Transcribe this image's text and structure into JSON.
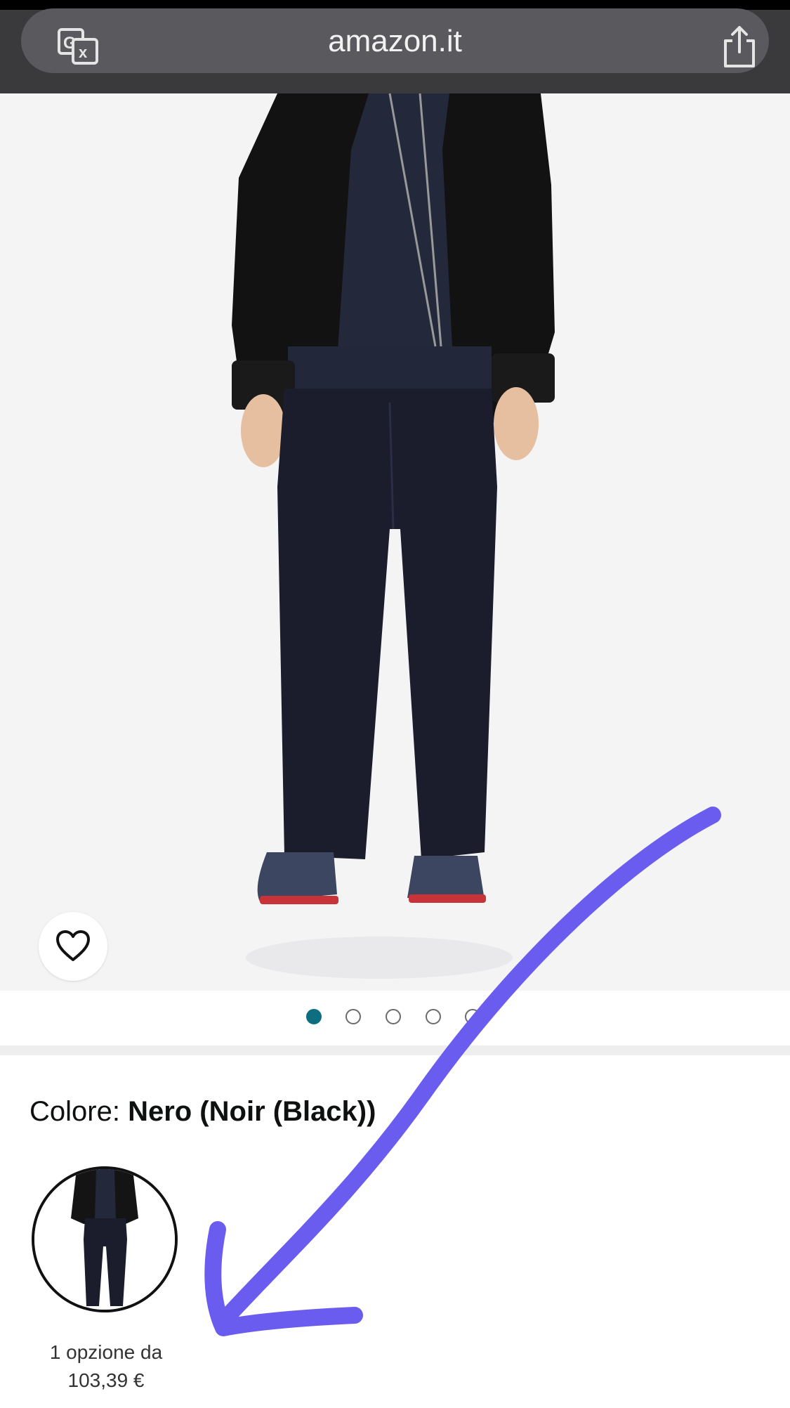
{
  "browser": {
    "url": "amazon.it"
  },
  "icons": {
    "translate": "translate-icon",
    "share": "share-icon",
    "wishlist": "heart-icon"
  },
  "carousel": {
    "total_dots": 5,
    "active_index": 0
  },
  "product": {
    "color_label": "Colore: ",
    "color_value": "Nero (Noir (Black))"
  },
  "swatch": {
    "caption_line1": "1 opzione da",
    "caption_line2": "103,39 €"
  },
  "colors": {
    "accent": "#0c6e80",
    "annotation": "#6b5cf0"
  }
}
